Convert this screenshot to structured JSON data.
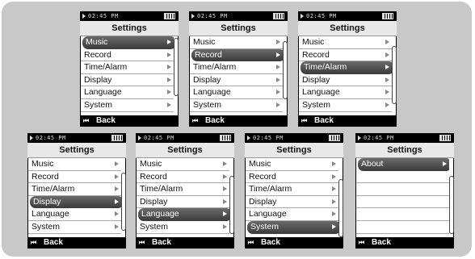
{
  "status": {
    "time": "02:45 PM"
  },
  "menu": {
    "title": "Settings",
    "items": [
      "Music",
      "Record",
      "Time/Alarm",
      "Display",
      "Language",
      "System"
    ],
    "back_label": "Back"
  },
  "submenu": {
    "items": [
      "About"
    ]
  },
  "colors": {
    "panel": "#c8c8c8",
    "selected": "#4a4a4a",
    "screen": "#000000"
  },
  "screens": [
    {
      "selected": 0
    },
    {
      "selected": 1
    },
    {
      "selected": 2
    },
    {
      "selected": 3
    },
    {
      "selected": 4
    },
    {
      "selected": 5
    },
    {
      "selected": 0,
      "submenu": true
    }
  ],
  "icons": {
    "play": "play-icon",
    "battery": "battery-icon",
    "back": "skip-back-icon"
  }
}
